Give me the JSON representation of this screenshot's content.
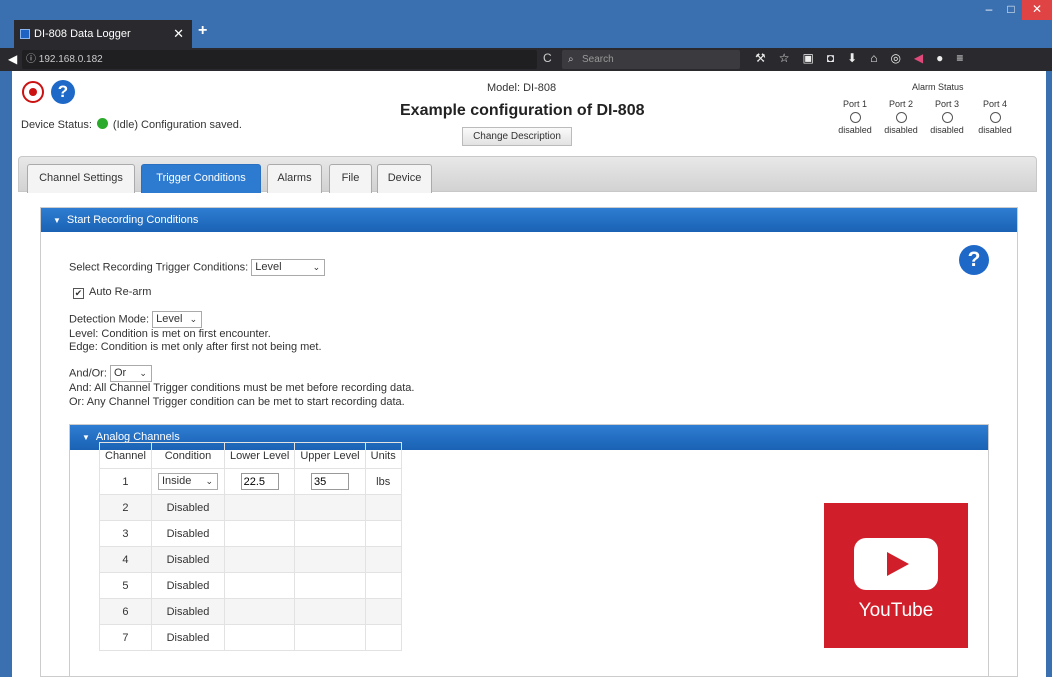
{
  "browser": {
    "tab_title": "DI-808 Data Logger",
    "tab_close": "✕",
    "new_tab": "+",
    "url": "192.168.0.182",
    "url_info": "ⓘ",
    "reload": "C",
    "search_placeholder": "Search",
    "window_controls": [
      "–",
      "□",
      "✕"
    ],
    "toolbar_icons": [
      "wrench-icon",
      "star-icon",
      "clipboard-icon",
      "pocket-icon",
      "download-icon",
      "home-icon",
      "extension-icon",
      "pin-icon",
      "account-icon",
      "menu-icon"
    ]
  },
  "header": {
    "model_label": "Model: DI-808",
    "config_title": "Example configuration of DI-808",
    "change_description_label": "Change Description",
    "device_status_label": "Device Status:",
    "device_status_text": "(Idle)  Configuration saved.",
    "status_color": "#2aaa2a"
  },
  "alarm_status": {
    "title": "Alarm Status",
    "ports": [
      {
        "name": "Port 1",
        "state": "disabled"
      },
      {
        "name": "Port 2",
        "state": "disabled"
      },
      {
        "name": "Port 3",
        "state": "disabled"
      },
      {
        "name": "Port 4",
        "state": "disabled"
      }
    ]
  },
  "tabs": [
    "Channel Settings",
    "Trigger Conditions",
    "Alarms",
    "File",
    "Device"
  ],
  "active_tab": "Trigger Conditions",
  "start_recording": {
    "header": "Start Recording Conditions",
    "select_trigger_label": "Select Recording Trigger Conditions:",
    "select_trigger_value": "Level",
    "auto_rearm_label": "Auto Re-arm",
    "auto_rearm_checked": "✔",
    "detection_mode_label": "Detection Mode:",
    "detection_mode_value": "Level",
    "level_desc": "Level: Condition is met on first encounter.",
    "edge_desc": "Edge: Condition is met only after first not being met.",
    "andor_label": "And/Or:",
    "andor_value": "Or",
    "and_desc": "And: All Channel Trigger conditions must be met before recording data.",
    "or_desc": "Or: Any Channel Trigger condition can be met to start recording data."
  },
  "analog_channels": {
    "header": "Analog Channels",
    "columns": [
      "Channel",
      "Condition",
      "Lower Level",
      "Upper Level",
      "Units"
    ],
    "rows": [
      {
        "channel": "1",
        "condition": "Inside",
        "lower": "22.5",
        "upper": "35",
        "units": "lbs"
      },
      {
        "channel": "2",
        "condition": "Disabled"
      },
      {
        "channel": "3",
        "condition": "Disabled"
      },
      {
        "channel": "4",
        "condition": "Disabled"
      },
      {
        "channel": "5",
        "condition": "Disabled"
      },
      {
        "channel": "6",
        "condition": "Disabled"
      },
      {
        "channel": "7",
        "condition": "Disabled"
      }
    ]
  },
  "youtube": {
    "label": "YouTube",
    "color": "#d01f2a"
  }
}
